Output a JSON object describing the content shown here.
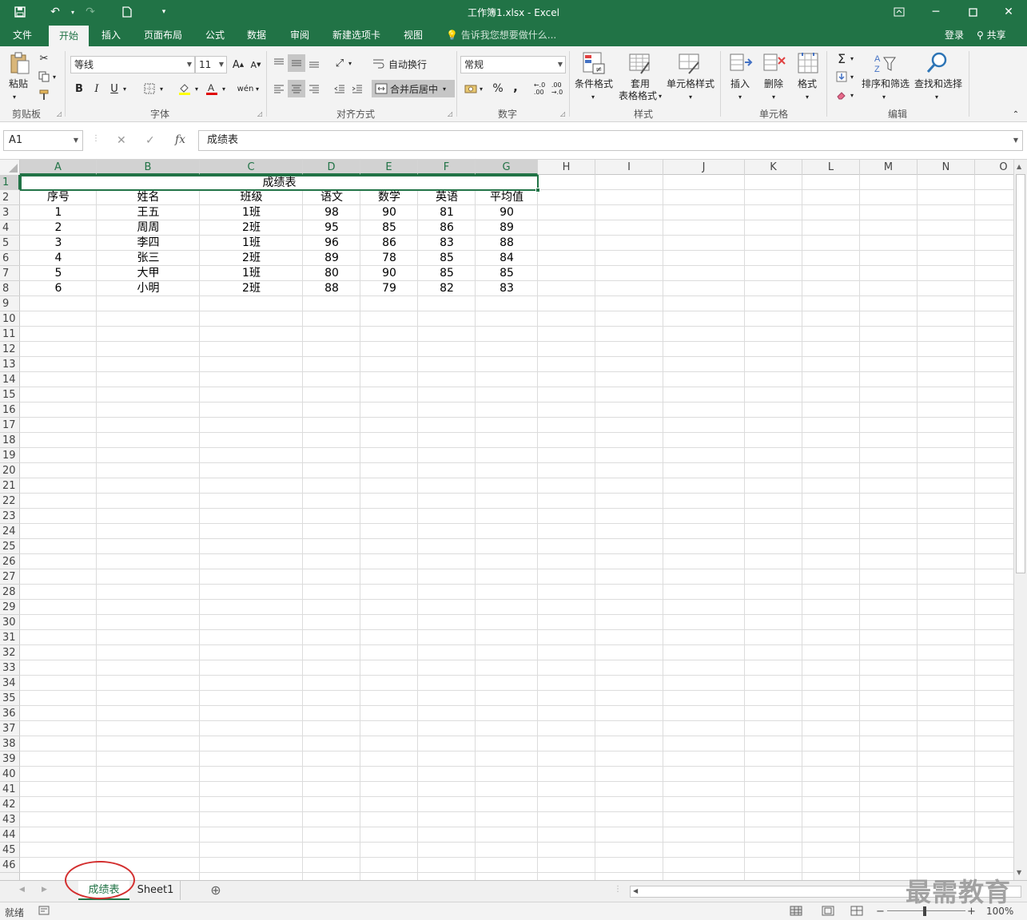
{
  "window": {
    "title": "工作簿1.xlsx - Excel"
  },
  "ribbon_tabs": [
    "文件",
    "开始",
    "插入",
    "页面布局",
    "公式",
    "数据",
    "审阅",
    "新建选项卡",
    "视图"
  ],
  "tell_me": "告诉我您想要做什么...",
  "account": {
    "login": "登录",
    "share": "共享"
  },
  "ribbon": {
    "clipboard": {
      "paste": "粘贴",
      "label": "剪贴板"
    },
    "font": {
      "name": "等线",
      "size": "11",
      "label": "字体",
      "bold": "B",
      "italic": "I",
      "underline": "U"
    },
    "alignment": {
      "wrap": "自动换行",
      "merge": "合并后居中",
      "label": "对齐方式"
    },
    "number": {
      "format": "常规",
      "percent": "%",
      "comma": ",",
      "label": "数字"
    },
    "styles": {
      "conditional": "条件格式",
      "table_fmt_1": "套用",
      "table_fmt_2": "表格格式",
      "cell_styles": "单元格样式",
      "label": "样式"
    },
    "cells": {
      "insert": "插入",
      "delete": "删除",
      "format": "格式",
      "label": "单元格"
    },
    "editing": {
      "sort": "排序和筛选",
      "find": "查找和选择",
      "label": "编辑"
    }
  },
  "formula_bar": {
    "name_box": "A1",
    "fx": "fx",
    "content": "成绩表"
  },
  "columns": [
    "A",
    "B",
    "C",
    "D",
    "E",
    "F",
    "G",
    "H",
    "I",
    "J",
    "K",
    "L",
    "M",
    "N",
    "O"
  ],
  "rows": [
    "1",
    "2",
    "3",
    "4",
    "5",
    "6",
    "7",
    "8",
    "9",
    "10",
    "11",
    "12",
    "13",
    "14",
    "15",
    "16",
    "17",
    "18",
    "19",
    "20",
    "21",
    "22",
    "23",
    "24",
    "25",
    "26",
    "27",
    "28",
    "29",
    "30",
    "31",
    "32",
    "33",
    "34",
    "35",
    "36",
    "37",
    "38",
    "39",
    "40",
    "41",
    "42",
    "43",
    "44",
    "45",
    "46"
  ],
  "sheet": {
    "title": "成绩表",
    "headers": [
      "序号",
      "姓名",
      "班级",
      "语文",
      "数学",
      "英语",
      "平均值"
    ],
    "data": [
      [
        "1",
        "王五",
        "1班",
        "98",
        "90",
        "81",
        "90"
      ],
      [
        "2",
        "周周",
        "2班",
        "95",
        "85",
        "86",
        "89"
      ],
      [
        "3",
        "李四",
        "1班",
        "96",
        "86",
        "83",
        "88"
      ],
      [
        "4",
        "张三",
        "2班",
        "89",
        "78",
        "85",
        "84"
      ],
      [
        "5",
        "大甲",
        "1班",
        "80",
        "90",
        "85",
        "85"
      ],
      [
        "6",
        "小明",
        "2班",
        "88",
        "79",
        "82",
        "83"
      ]
    ]
  },
  "sheet_tabs": [
    "成绩表",
    "Sheet1"
  ],
  "status": {
    "ready": "就绪",
    "zoom": "100%"
  },
  "watermark": "最需教育",
  "colors": {
    "accent": "#217346",
    "annotation": "#d32f2f"
  }
}
